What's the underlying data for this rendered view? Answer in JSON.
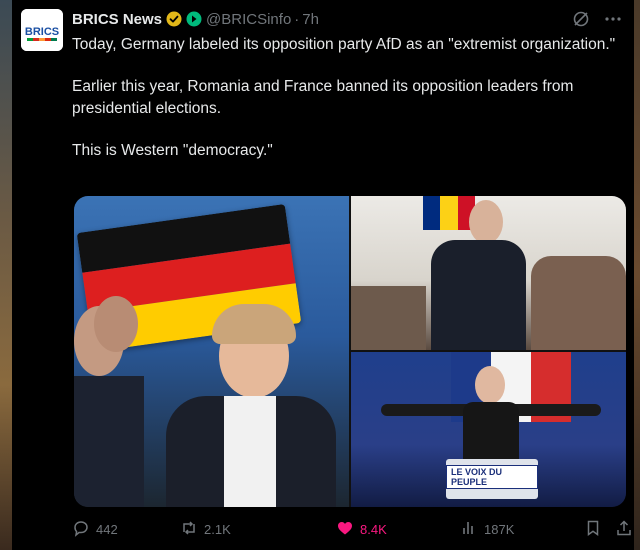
{
  "tweet": {
    "account_name": "BRICS News",
    "avatar_text": "BRICS",
    "handle": "@BRICSinfo",
    "separator": "·",
    "time": "7h",
    "paragraphs": [
      "Today, Germany labeled its opposition party AfD as an \"extremist organization.\"",
      "Earlier this year, Romania and France banned its opposition leaders from presidential elections.",
      "This is Western \"democracy.\""
    ]
  },
  "media": {
    "podium_text": "LE VOIX DU PEUPLE"
  },
  "actions": {
    "replies": "442",
    "reposts": "2.1K",
    "likes": "8.4K",
    "views": "187K"
  },
  "colors": {
    "background": "#000000",
    "text": "#e7e9ea",
    "muted": "#71767b",
    "like": "#f91880",
    "verified_gold": "#e2b719",
    "affiliate_green": "#00ba7c"
  },
  "icons": [
    "grok-icon",
    "more-icon",
    "verified-badge-icon",
    "affiliate-badge-icon",
    "reply-icon",
    "repost-icon",
    "like-icon",
    "views-icon",
    "bookmark-icon",
    "share-icon"
  ]
}
